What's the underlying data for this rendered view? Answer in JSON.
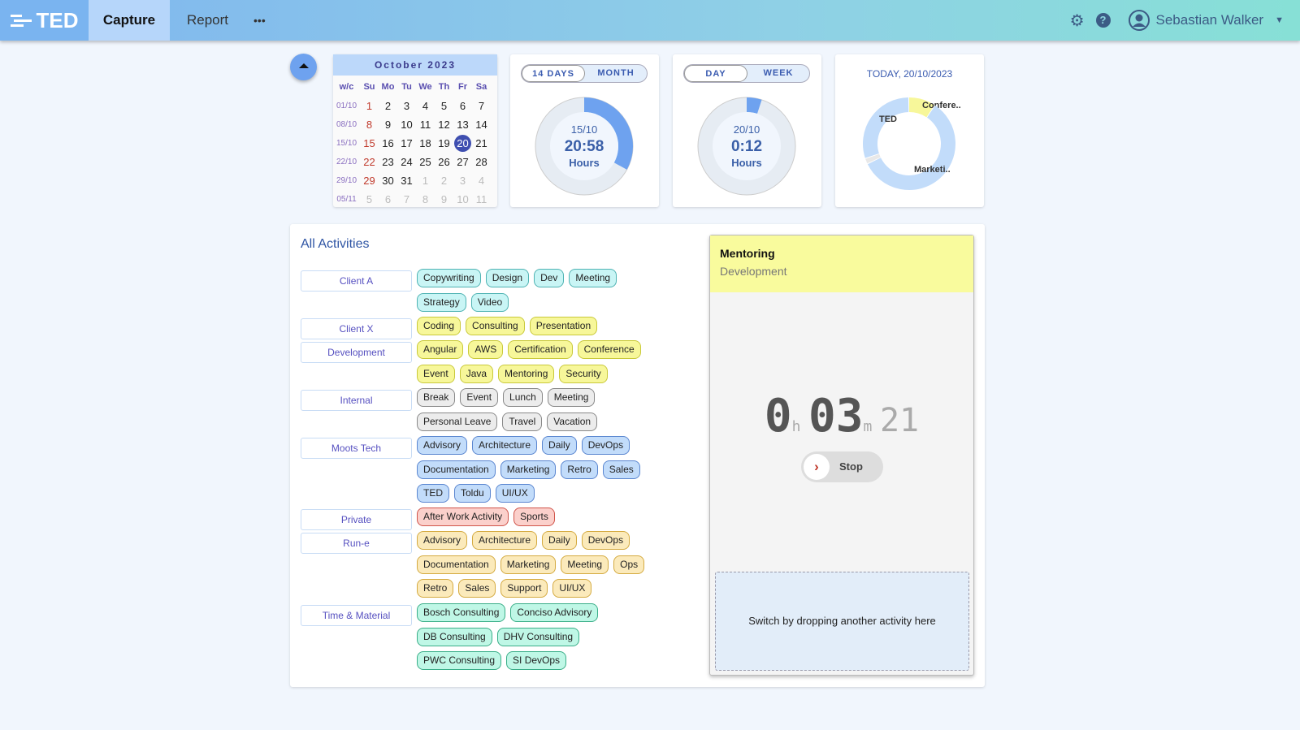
{
  "header": {
    "logo": "TED",
    "tabs": [
      "Capture",
      "Report"
    ],
    "more": "•••",
    "user": "Sebastian Walker"
  },
  "calendar": {
    "month": "October 2023",
    "headers": [
      "w/c",
      "Su",
      "Mo",
      "Tu",
      "We",
      "Th",
      "Fr",
      "Sa"
    ],
    "weeks": [
      {
        "wc": "01/10",
        "days": [
          "1",
          "2",
          "3",
          "4",
          "5",
          "6",
          "7"
        ]
      },
      {
        "wc": "08/10",
        "days": [
          "8",
          "9",
          "10",
          "11",
          "12",
          "13",
          "14"
        ]
      },
      {
        "wc": "15/10",
        "days": [
          "15",
          "16",
          "17",
          "18",
          "19",
          "20",
          "21"
        ]
      },
      {
        "wc": "22/10",
        "days": [
          "22",
          "23",
          "24",
          "25",
          "26",
          "27",
          "28"
        ]
      },
      {
        "wc": "29/10",
        "days": [
          "29",
          "30",
          "31",
          "1",
          "2",
          "3",
          "4"
        ]
      },
      {
        "wc": "05/11",
        "days": [
          "5",
          "6",
          "7",
          "8",
          "9",
          "10",
          "11"
        ]
      }
    ],
    "selected": "20"
  },
  "period_widget": {
    "options": [
      "14 DAYS",
      "MONTH"
    ],
    "active": "14 DAYS",
    "date": "15/10",
    "value": "20:58",
    "unit": "Hours",
    "progress": 0.33
  },
  "day_widget": {
    "options": [
      "DAY",
      "WEEK"
    ],
    "active": "DAY",
    "date": "20/10",
    "value": "0:12",
    "unit": "Hours",
    "progress": 0.05
  },
  "today_widget": {
    "title": "TODAY, 20/10/2023",
    "slices": [
      {
        "label": "Confere..",
        "value": 0.095,
        "color": "#f7f79a"
      },
      {
        "label": "Marketi..",
        "value": 0.585,
        "color": "#c2dcfa"
      },
      {
        "label": "",
        "value": 0.02,
        "color": "#e8e8e8"
      },
      {
        "label": "TED",
        "value": 0.3,
        "color": "#c2dcfa"
      }
    ]
  },
  "activities": {
    "title": "All Activities",
    "groups": [
      {
        "name": "Client A",
        "bg": "#c9f5f5",
        "border": "#4fb3b3",
        "items": [
          "Copywriting",
          "Design",
          "Dev",
          "Meeting",
          "Strategy",
          "Video"
        ]
      },
      {
        "name": "Client X",
        "bg": "#f7f79a",
        "border": "#c9c93a",
        "items": [
          "Coding",
          "Consulting",
          "Presentation"
        ]
      },
      {
        "name": "Development",
        "bg": "#f7f79a",
        "border": "#c9c93a",
        "items": [
          "Angular",
          "AWS",
          "Certification",
          "Conference",
          "Event",
          "Java",
          "Mentoring",
          "Security"
        ]
      },
      {
        "name": "Internal",
        "bg": "#ececec",
        "border": "#888",
        "items": [
          "Break",
          "Event",
          "Lunch",
          "Meeting",
          "Personal Leave",
          "Travel",
          "Vacation"
        ]
      },
      {
        "name": "Moots Tech",
        "bg": "#c2dcfa",
        "border": "#5a86d0",
        "items": [
          "Advisory",
          "Architecture",
          "Daily",
          "DevOps",
          "Documentation",
          "Marketing",
          "Retro",
          "Sales",
          "TED",
          "Toldu",
          "UI/UX"
        ]
      },
      {
        "name": "Private",
        "bg": "#fbd0cb",
        "border": "#d0544a",
        "items": [
          "After Work Activity",
          "Sports"
        ]
      },
      {
        "name": "Run-e",
        "bg": "#fbeabb",
        "border": "#d4aa40",
        "items": [
          "Advisory",
          "Architecture",
          "Daily",
          "DevOps",
          "Documentation",
          "Marketing",
          "Meeting",
          "Ops",
          "Retro",
          "Sales",
          "Support",
          "UI/UX"
        ]
      },
      {
        "name": "Time & Material",
        "bg": "#bff7e6",
        "border": "#3aae88",
        "items": [
          "Bosch Consulting",
          "Conciso Advisory",
          "DB Consulting",
          "DHV Consulting",
          "PWC Consulting",
          "SI DevOps"
        ]
      }
    ]
  },
  "timer": {
    "activity": "Mentoring",
    "group": "Development",
    "hours": "0",
    "h": "h",
    "minutes": "03",
    "m": "m",
    "seconds": "21",
    "stop": "Stop",
    "drop_hint": "Switch by dropping another activity here"
  }
}
